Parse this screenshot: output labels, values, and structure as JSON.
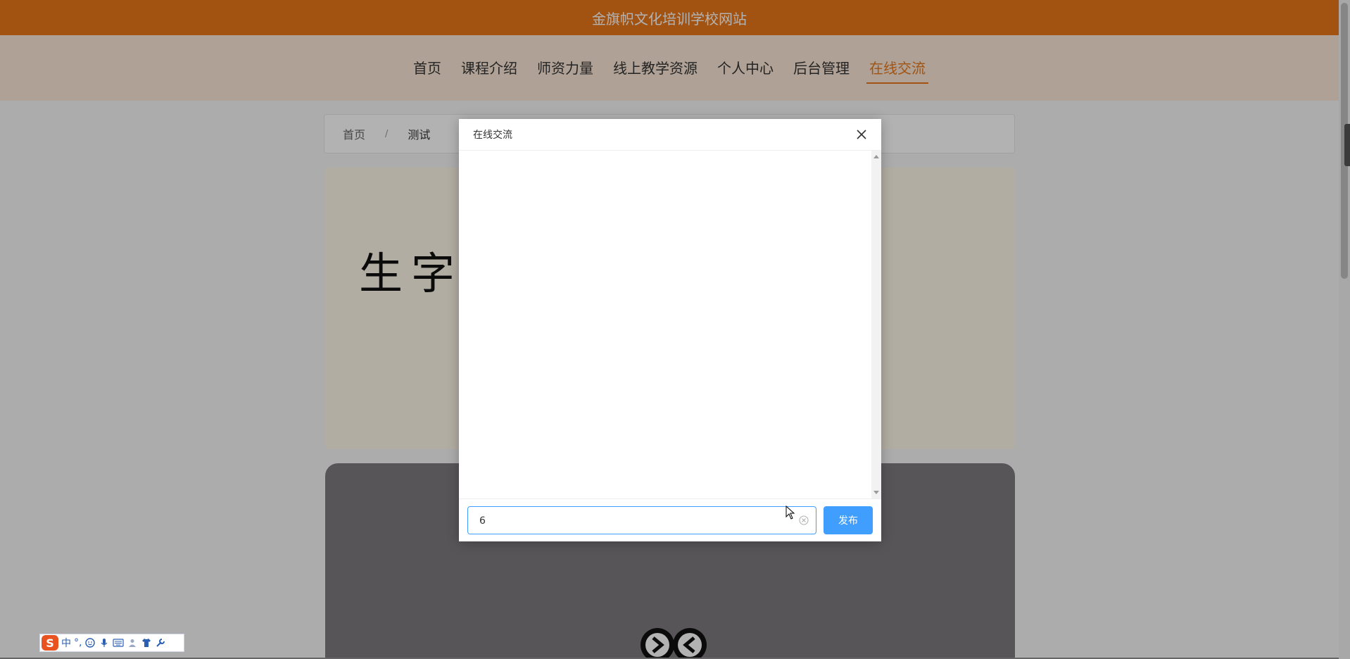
{
  "site": {
    "title": "金旗帜文化培训学校网站"
  },
  "nav": {
    "items": [
      {
        "label": "首页"
      },
      {
        "label": "课程介绍"
      },
      {
        "label": "师资力量"
      },
      {
        "label": "线上教学资源"
      },
      {
        "label": "个人中心"
      },
      {
        "label": "后台管理"
      },
      {
        "label": "在线交流",
        "active": true
      }
    ]
  },
  "breadcrumb": {
    "home": "首页",
    "separator": "/",
    "current": "测试"
  },
  "banner": {
    "text": "生字"
  },
  "dialog": {
    "title": "在线交流",
    "input_value": "6",
    "publish_label": "发布"
  },
  "ime": {
    "logo": "S",
    "mode": "中",
    "punct": "°,"
  },
  "colors": {
    "accent": "#e8781a",
    "primary": "#409eff"
  }
}
